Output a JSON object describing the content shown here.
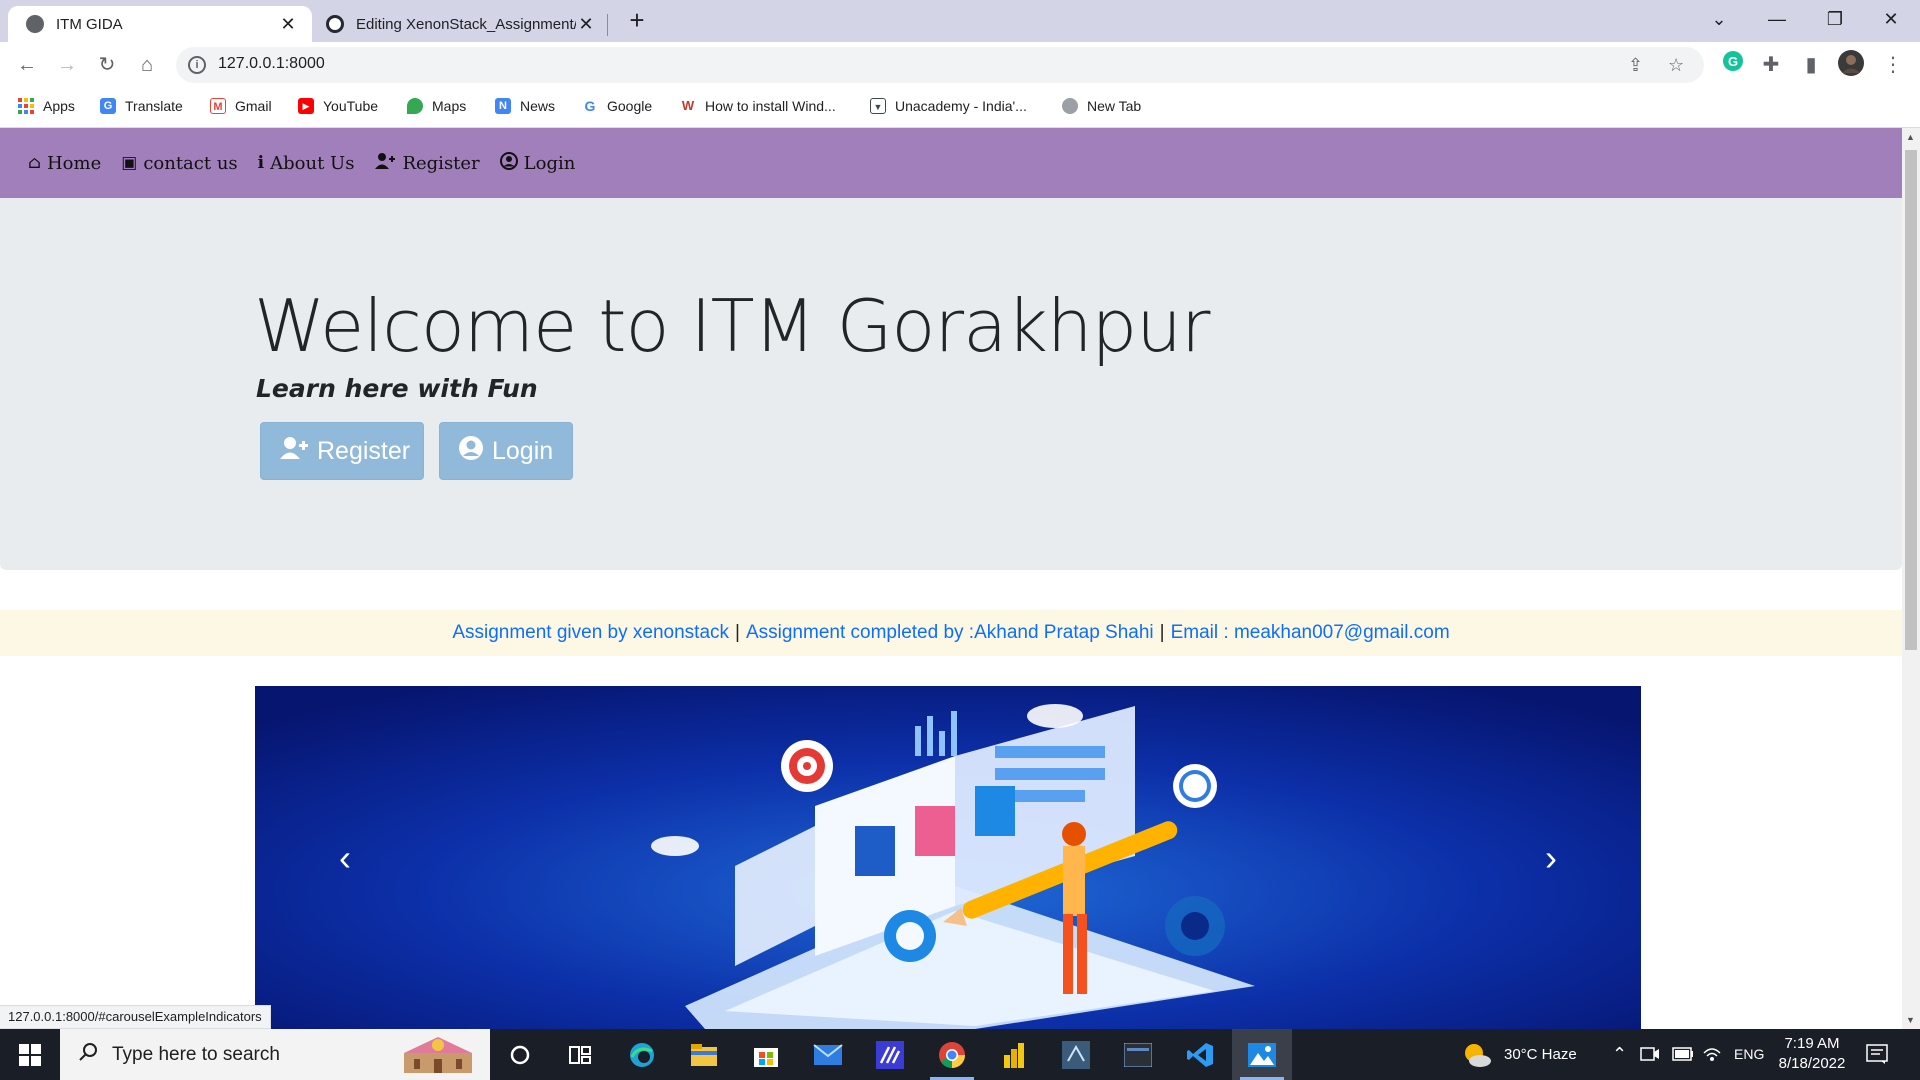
{
  "browser": {
    "tabs": [
      {
        "title": "ITM GIDA",
        "active": true
      },
      {
        "title": "Editing XenonStack_Assignment/",
        "active": false
      }
    ],
    "new_tab_glyph": "+",
    "window_controls": {
      "minimize": "—",
      "restore": "❐",
      "close": "✕",
      "tab_search": "⌄"
    },
    "url": "127.0.0.1:8000",
    "bookmarks": [
      {
        "label": "Apps",
        "icon": "apps-grid-icon",
        "color": "#ea4335"
      },
      {
        "label": "Translate",
        "icon": "translate-icon",
        "color": "#4285f4"
      },
      {
        "label": "Gmail",
        "icon": "gmail-icon",
        "color": "#ea4335"
      },
      {
        "label": "YouTube",
        "icon": "youtube-icon",
        "color": "#ff0000"
      },
      {
        "label": "Maps",
        "icon": "maps-icon",
        "color": "#34a853"
      },
      {
        "label": "News",
        "icon": "news-icon",
        "color": "#4285f4"
      },
      {
        "label": "Google",
        "icon": "google-icon",
        "color": "#4285f4"
      },
      {
        "label": "How to install Wind...",
        "icon": "site-icon",
        "color": "#b06ab3"
      },
      {
        "label": "Unacademy - India'...",
        "icon": "unacademy-icon",
        "color": "#3c4852"
      },
      {
        "label": "New Tab",
        "icon": "globe-icon",
        "color": "#9aa0a6"
      }
    ],
    "status_url": "127.0.0.1:8000/#carouselExampleIndicators"
  },
  "page": {
    "nav": [
      {
        "label": "Home",
        "icon": "home-icon"
      },
      {
        "label": "contact us",
        "icon": "contact-card-icon"
      },
      {
        "label": "About Us",
        "icon": "info-icon"
      },
      {
        "label": "Register",
        "icon": "user-plus-icon"
      },
      {
        "label": "Login",
        "icon": "user-circle-icon"
      }
    ],
    "hero": {
      "title": "Welcome to ITM Gorakhpur",
      "subtitle": "Learn here with Fun",
      "register_label": "Register",
      "login_label": "Login"
    },
    "info": {
      "given_by": "Assignment given by xenonstack",
      "completed_by": "Assignment completed by :Akhand Pratap Shahi",
      "email": "Email : meakhan007@gmail.com",
      "separator": "|"
    },
    "carousel": {
      "prev": "‹",
      "next": "›"
    }
  },
  "colors": {
    "navbar": "#a17fba",
    "jumbotron": "#e9ecef",
    "button": "#91b9d9",
    "info_bg": "#fdf8e4",
    "link": "#0d6efd"
  },
  "taskbar": {
    "search_placeholder": "Type here to search",
    "apps": [
      "cortana-icon",
      "task-view-icon",
      "edge-icon",
      "file-explorer-icon",
      "store-icon",
      "mail-icon",
      "app-icon",
      "chrome-icon",
      "power-bi-icon",
      "ssms-icon",
      "mysql-workbench-icon",
      "vscode-icon",
      "photos-icon"
    ],
    "weather": "30°C  Haze",
    "language": "ENG",
    "time": "7:19 AM",
    "date": "8/18/2022"
  }
}
